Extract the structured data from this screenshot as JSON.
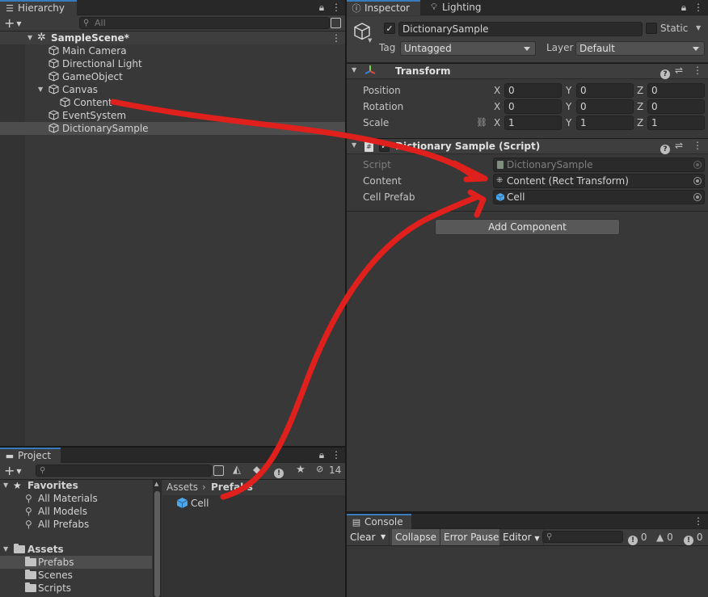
{
  "hierarchy": {
    "tab_label": "Hierarchy",
    "search_placeholder": "All",
    "scene_name": "SampleScene*",
    "items": [
      {
        "label": "Main Camera"
      },
      {
        "label": "Directional Light"
      },
      {
        "label": "GameObject"
      },
      {
        "label": "Canvas"
      },
      {
        "label": "Content"
      },
      {
        "label": "EventSystem"
      },
      {
        "label": "DictionarySample"
      }
    ]
  },
  "inspector": {
    "tab_inspector": "Inspector",
    "tab_lighting": "Lighting",
    "object_name": "DictionarySample",
    "static_label": "Static",
    "tag_label": "Tag",
    "tag_value": "Untagged",
    "layer_label": "Layer",
    "layer_value": "Default",
    "transform": {
      "title": "Transform",
      "position_label": "Position",
      "rotation_label": "Rotation",
      "scale_label": "Scale",
      "axis_x": "X",
      "axis_y": "Y",
      "axis_z": "Z",
      "position": [
        "0",
        "0",
        "0"
      ],
      "rotation": [
        "0",
        "0",
        "0"
      ],
      "scale": [
        "1",
        "1",
        "1"
      ]
    },
    "script_component": {
      "title": "Dictionary Sample (Script)",
      "script_label": "Script",
      "script_value": "DictionarySample",
      "content_label": "Content",
      "content_value": "Content (Rect Transform)",
      "cell_prefab_label": "Cell Prefab",
      "cell_prefab_value": "Cell"
    },
    "add_component": "Add Component"
  },
  "project": {
    "tab_label": "Project",
    "hidden_count": "14",
    "favorites_label": "Favorites",
    "favorites": [
      "All Materials",
      "All Models",
      "All Prefabs"
    ],
    "assets_label": "Assets",
    "asset_folders": [
      "Prefabs",
      "Scenes",
      "Scripts"
    ],
    "breadcrumb_root": "Assets",
    "breadcrumb_current": "Prefabs",
    "files": [
      "Cell"
    ]
  },
  "console": {
    "tab_label": "Console",
    "clear_label": "Clear",
    "collapse_label": "Collapse",
    "error_pause_label": "Error Pause",
    "editor_label": "Editor",
    "log_count": "0",
    "warning_count": "0",
    "error_count": "0"
  },
  "colors": {
    "panel_bg": "#383838",
    "selection": "#4d4d4d",
    "accent_tab": "#3a79bb",
    "annotation_red": "#e0201c",
    "prefab_blue": "#4fa6e8"
  }
}
